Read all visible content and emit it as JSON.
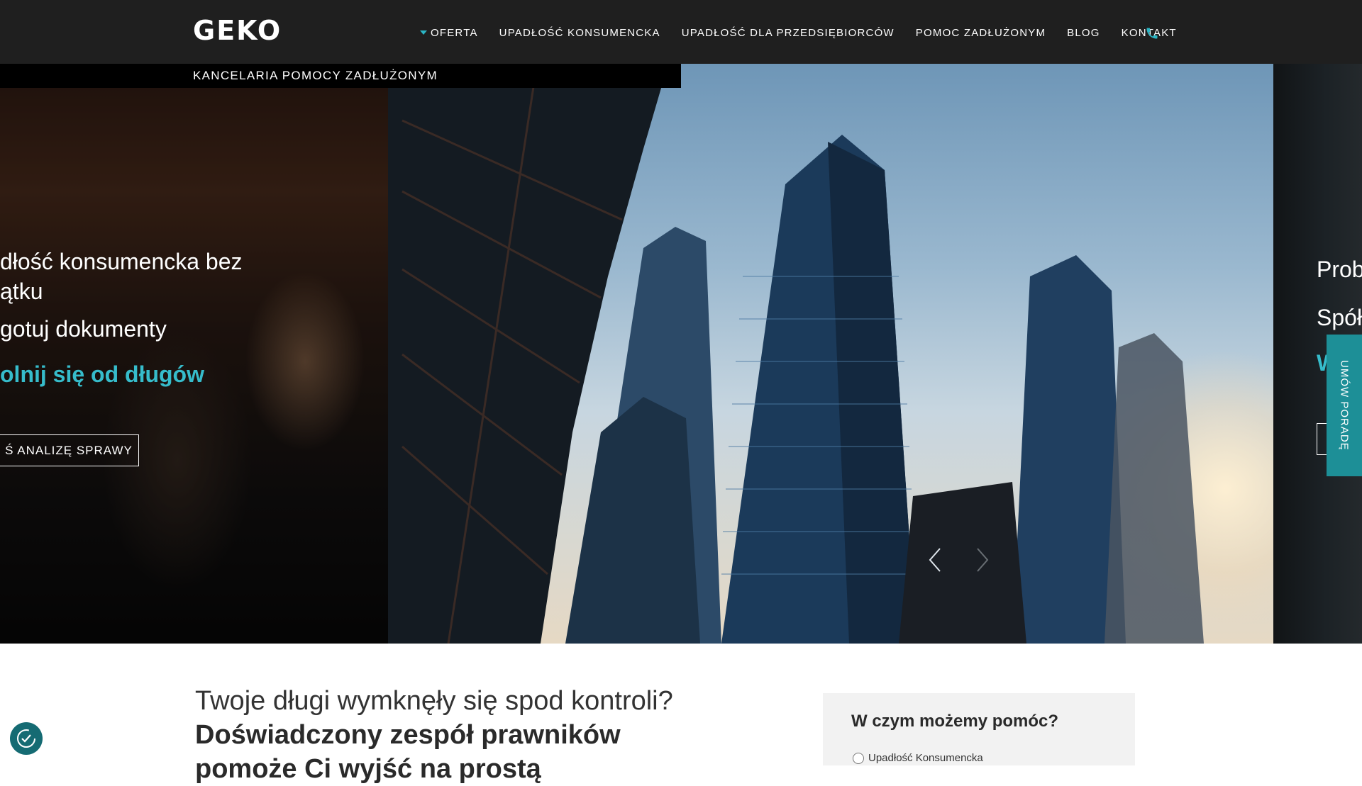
{
  "header": {
    "logo_text": "GEKO",
    "nav": [
      {
        "label": "OFERTA",
        "has_dropdown": true
      },
      {
        "label": "UPADŁOŚĆ KONSUMENCKA"
      },
      {
        "label": "UPADŁOŚĆ DLA PRZEDSIĘBIORCÓW"
      },
      {
        "label": "POMOC ZADŁUŻONYM"
      },
      {
        "label": "BLOG"
      },
      {
        "label": "KONTAKT"
      }
    ],
    "phone_icon": "phone-icon",
    "tagline": "KANCELARIA POMOCY ZADŁUŻONYM"
  },
  "slider": {
    "left_slide": {
      "line1a": "dłość konsumencka bez",
      "line1b": "ątku",
      "line2": "gotuj dokumenty",
      "line3": "olnij się od długów",
      "button": "Ś ANALIZĘ SPRAWY"
    },
    "right_slide": {
      "line1": "Prob",
      "line2": "Spół",
      "line3": "W"
    },
    "prev_icon": "chevron-left-icon",
    "next_icon": "chevron-right-icon"
  },
  "side_tab": {
    "label": "UMÓW PORADĘ"
  },
  "intro": {
    "line1": "Twoje długi wymknęły się spod kontroli?",
    "line2": "Doświadczony zespół prawników",
    "line3": "pomoże Ci wyjść na prostą"
  },
  "help_box": {
    "title": "W czym możemy pomóc?",
    "options": [
      "Upadłość Konsumencka"
    ]
  },
  "accessibility": {
    "icon": "accessibility-icon"
  },
  "colors": {
    "accent": "#36bccb",
    "header_bg": "#1f1f1f",
    "tab_bg": "#1d8f97"
  }
}
